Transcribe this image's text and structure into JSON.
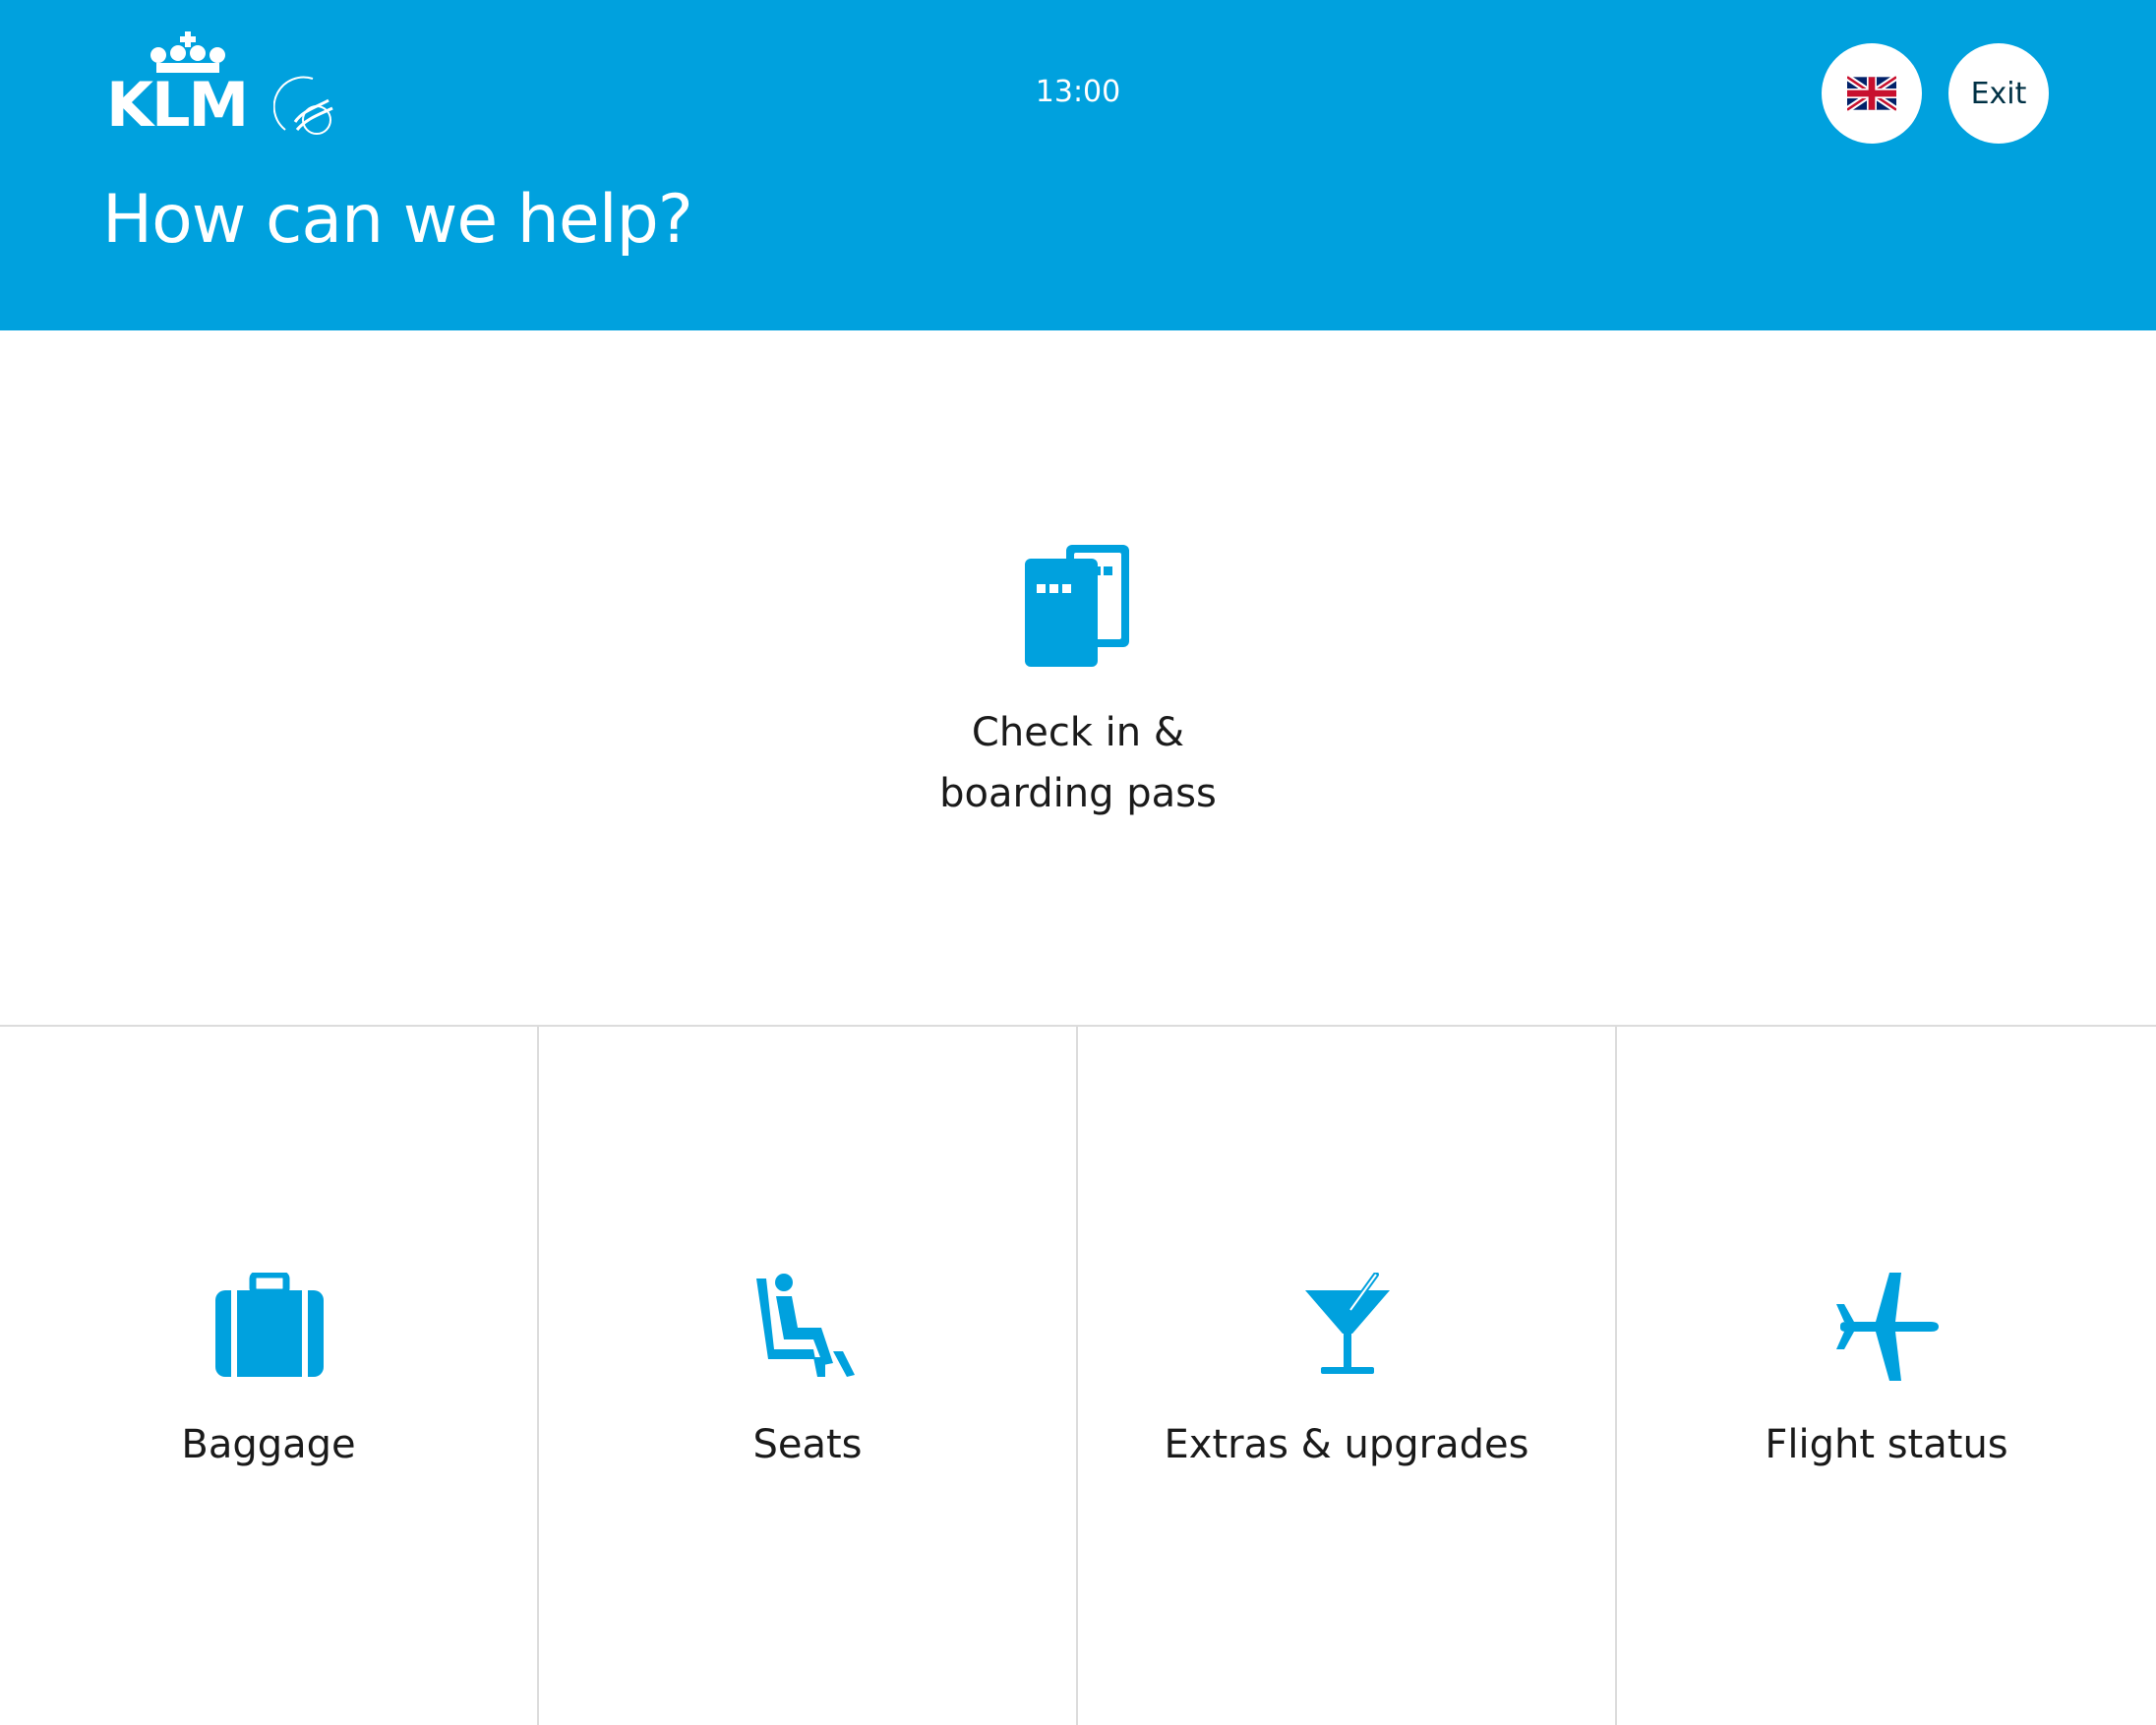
{
  "header": {
    "brand": "KLM",
    "alliance": "SKYTEAM",
    "time": "13:00",
    "title": "How can we help?",
    "language_icon": "uk-flag-icon",
    "exit_label": "Exit"
  },
  "main_option": {
    "label_line1": "Check in &",
    "label_line2": "boarding pass",
    "icon": "boarding-pass-icon"
  },
  "options": [
    {
      "label": "Baggage",
      "icon": "suitcase-icon"
    },
    {
      "label": "Seats",
      "icon": "seat-icon"
    },
    {
      "label": "Extras & upgrades",
      "icon": "cocktail-icon"
    },
    {
      "label": "Flight status",
      "icon": "airplane-icon"
    }
  ],
  "colors": {
    "brand_blue": "#00a1de",
    "text_dark": "#1a1a1a",
    "divider": "#dcdcdc",
    "exit_text": "#003145"
  }
}
